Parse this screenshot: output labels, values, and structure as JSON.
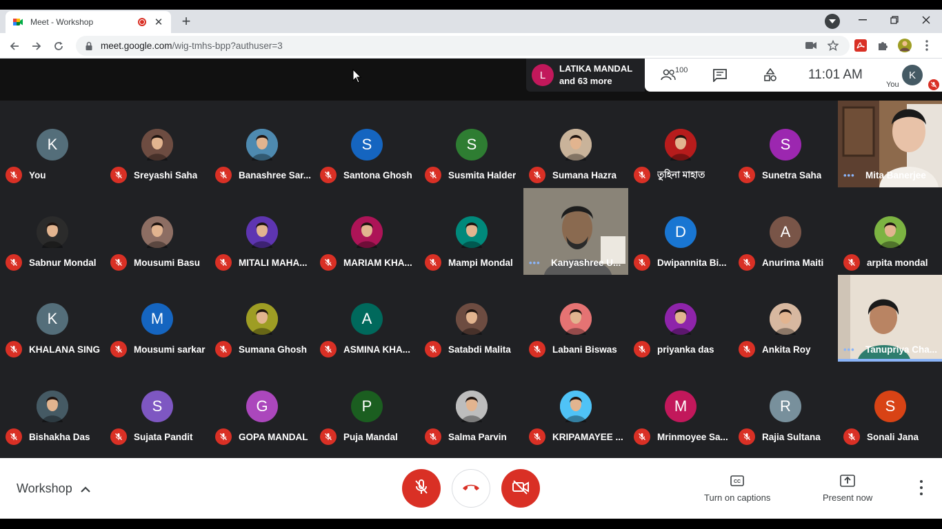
{
  "browser": {
    "tab_title": "Meet - Workshop",
    "tab_close": "✕",
    "new_tab": "+",
    "url_host": "meet.google.com",
    "url_path": "/wig-tmhs-bpp?authuser=3"
  },
  "meet_header": {
    "presenter_initial": "L",
    "presenter_line1": "LATIKA MANDAL",
    "presenter_line2": "and 63 more",
    "people_count": "100",
    "time": "11:01 AM",
    "you_label": "You",
    "you_initial": "K"
  },
  "participants": [
    {
      "name": "You",
      "initial": "K",
      "color": "#546e7a",
      "type": "letter",
      "muted": true
    },
    {
      "name": "Sreyashi Saha",
      "type": "photo",
      "color": "#6d4c41",
      "muted": true
    },
    {
      "name": "Banashree Sar...",
      "type": "photo",
      "color": "#4e8ab0",
      "muted": true
    },
    {
      "name": "Santona Ghosh",
      "initial": "S",
      "color": "#1565c0",
      "type": "letter",
      "muted": true
    },
    {
      "name": "Susmita Halder",
      "initial": "S",
      "color": "#2e7d32",
      "type": "letter",
      "muted": true
    },
    {
      "name": "Sumana Hazra",
      "type": "photo",
      "color": "#c9b39a",
      "muted": true
    },
    {
      "name": "তুহিনা মাহাত",
      "type": "photo",
      "color": "#b71c1c",
      "muted": true
    },
    {
      "name": "Sunetra Saha",
      "initial": "S",
      "color": "#9c27b0",
      "type": "letter",
      "muted": true
    },
    {
      "name": "Mita Banerjee",
      "type": "video",
      "muted": false
    },
    {
      "name": "Sabnur Mondal",
      "type": "photo",
      "color": "#2b2b2b",
      "muted": true
    },
    {
      "name": "Mousumi Basu",
      "type": "photo",
      "color": "#8d6e63",
      "muted": true
    },
    {
      "name": "MITALI MAHA...",
      "type": "photo",
      "color": "#5e35b1",
      "muted": true
    },
    {
      "name": "MARIAM KHA...",
      "type": "photo",
      "color": "#ad1457",
      "muted": true
    },
    {
      "name": "Mampi Mondal",
      "type": "photo",
      "color": "#00897b",
      "muted": true
    },
    {
      "name": "Kanyashree U...",
      "type": "video",
      "muted": false
    },
    {
      "name": "Dwipannita Bi...",
      "initial": "D",
      "color": "#1976d2",
      "type": "letter",
      "muted": true
    },
    {
      "name": "Anurima Maiti",
      "initial": "A",
      "color": "#795548",
      "type": "letter",
      "muted": true
    },
    {
      "name": "arpita mondal",
      "type": "photo",
      "color": "#7cb342",
      "muted": true
    },
    {
      "name": "KHALANA SING",
      "initial": "K",
      "color": "#546e7a",
      "type": "letter",
      "muted": true
    },
    {
      "name": "Mousumi sarkar",
      "initial": "M",
      "color": "#1565c0",
      "type": "letter",
      "muted": true
    },
    {
      "name": "Sumana Ghosh",
      "type": "photo",
      "color": "#9e9d24",
      "muted": true
    },
    {
      "name": "ASMINA KHA...",
      "initial": "A",
      "color": "#00695c",
      "type": "letter",
      "muted": true
    },
    {
      "name": "Satabdi Malita",
      "type": "photo",
      "color": "#6d4c41",
      "muted": true
    },
    {
      "name": "Labani Biswas",
      "type": "photo",
      "color": "#e57373",
      "muted": true
    },
    {
      "name": "priyanka das",
      "type": "photo",
      "color": "#8e24aa",
      "muted": true
    },
    {
      "name": "Ankita Roy",
      "type": "photo",
      "color": "#d7b8a0",
      "muted": true
    },
    {
      "name": "Tanupriya Cha...",
      "type": "video",
      "muted": false
    },
    {
      "name": "Bishakha Das",
      "type": "photo",
      "color": "#455a64",
      "muted": true
    },
    {
      "name": "Sujata Pandit",
      "initial": "S",
      "color": "#7e57c2",
      "type": "letter",
      "muted": true
    },
    {
      "name": "GOPA MANDAL",
      "initial": "G",
      "color": "#ab47bc",
      "type": "letter",
      "muted": true
    },
    {
      "name": "Puja Mandal",
      "initial": "P",
      "color": "#1b5e20",
      "type": "letter",
      "muted": true
    },
    {
      "name": "Salma Parvin",
      "type": "photo",
      "color": "#bdbdbd",
      "muted": true
    },
    {
      "name": "KRIPAMAYEE ...",
      "type": "photo",
      "color": "#4fc3f7",
      "muted": true
    },
    {
      "name": "Mrinmoyee Sa...",
      "initial": "M",
      "color": "#c2185b",
      "type": "letter",
      "muted": true
    },
    {
      "name": "Rajia Sultana",
      "initial": "R",
      "color": "#78909c",
      "type": "letter",
      "muted": true
    },
    {
      "name": "Sonali Jana",
      "initial": "S",
      "color": "#d84315",
      "type": "letter",
      "muted": true
    }
  ],
  "bottom": {
    "meeting_name": "Workshop",
    "captions_label": "Turn on captions",
    "present_label": "Present now"
  },
  "colors": {
    "danger": "#d93025",
    "speaking": "#8ab4f8",
    "grid_bg": "#202124"
  }
}
